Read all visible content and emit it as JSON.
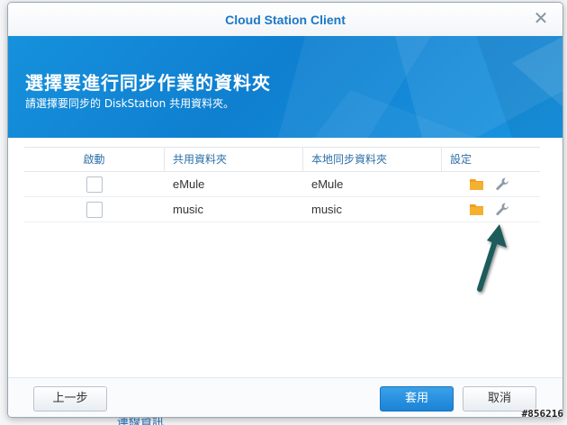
{
  "window": {
    "title": "Cloud Station Client"
  },
  "banner": {
    "title": "選擇要進行同步作業的資料夾",
    "subtitle": "請選擇要同步的 DiskStation 共用資料夾。"
  },
  "table": {
    "headers": [
      "啟動",
      "共用資料夾",
      "本地同步資料夾",
      "設定"
    ],
    "rows": [
      {
        "enabled": false,
        "shared_folder": "eMule",
        "local_folder": "eMule"
      },
      {
        "enabled": false,
        "shared_folder": "music",
        "local_folder": "music"
      }
    ]
  },
  "footer": {
    "back_label": "上一步",
    "apply_label": "套用",
    "cancel_label": "取消"
  },
  "background": {
    "link_text": "連線資訊"
  },
  "watermark": "#856216",
  "colors": {
    "accent": "#1c77c7",
    "banner": "#1488d8",
    "folder": "#f0a020",
    "arrow": "#1f5c5a"
  }
}
